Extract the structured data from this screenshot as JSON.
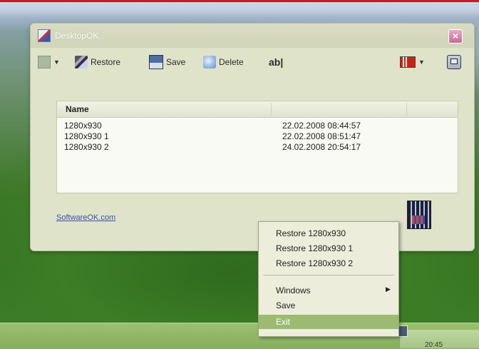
{
  "window": {
    "title": "DesktopOK",
    "close_label": "×"
  },
  "toolbar": {
    "restore_label": "Restore",
    "save_label": "Save",
    "delete_label": "Delete",
    "text_label": "ab|"
  },
  "list": {
    "column_name": "Name",
    "rows": [
      {
        "name": "1280x930",
        "date": "22.02.2008 08:44:57"
      },
      {
        "name": "1280x930 1",
        "date": "22.02.2008 08:51:47"
      },
      {
        "name": "1280x930 2",
        "date": "24.02.2008 20:54:17"
      }
    ]
  },
  "footer": {
    "link": "SoftwareOK.com"
  },
  "menu": {
    "items": [
      {
        "label": "Restore 1280x930"
      },
      {
        "label": "Restore 1280x930 1"
      },
      {
        "label": "Restore 1280x930 2"
      },
      {
        "label": "Windows"
      },
      {
        "label": "Save"
      },
      {
        "label": "Exit"
      }
    ]
  },
  "tray": {
    "time": "20:45"
  },
  "colors": {
    "accent": "#9cba72",
    "link": "#3e4fb0",
    "window_bg": "#dfe3c9"
  }
}
